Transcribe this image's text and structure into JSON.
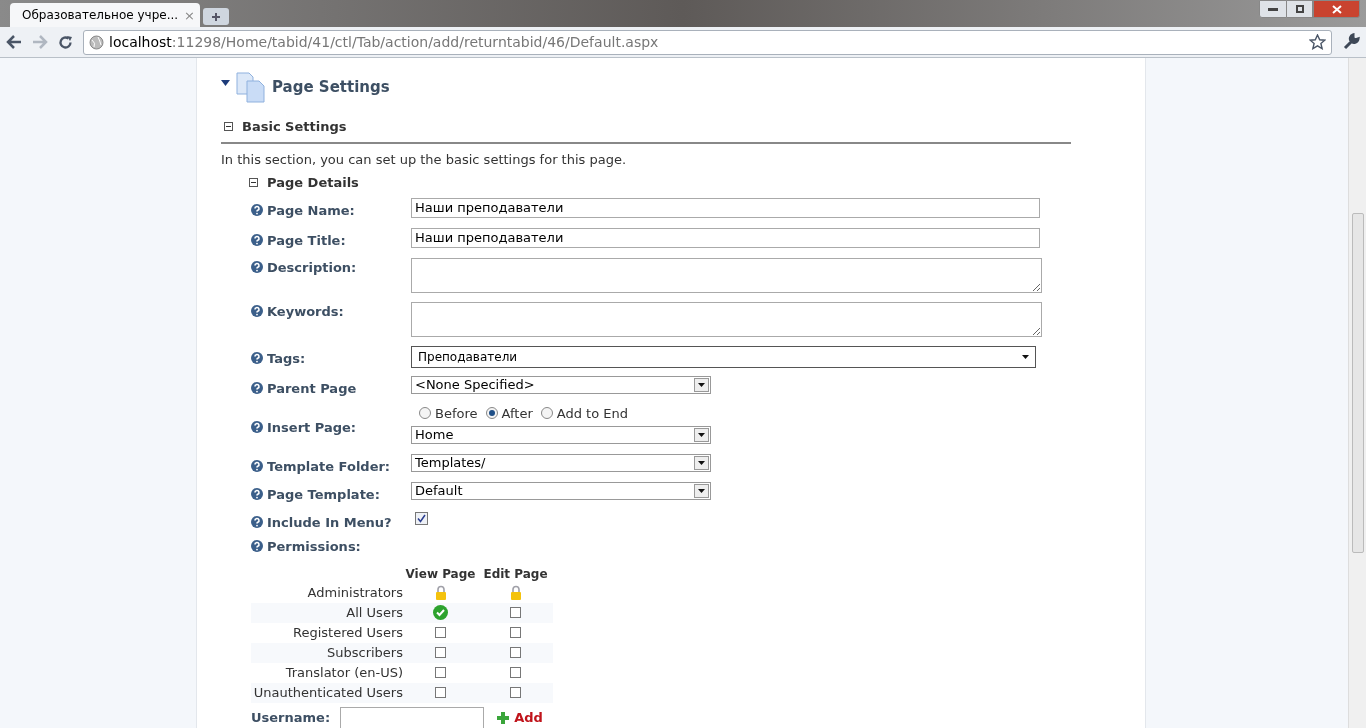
{
  "browser": {
    "tab_title": "Образовательное учре...",
    "tab_close": "×",
    "url_host": "localhost",
    "url_path": ":11298/Home/tabid/41/ctl/Tab/action/add/returntabid/46/Default.aspx"
  },
  "page": {
    "title": "Page Settings",
    "expanded": true
  },
  "section": {
    "title": "Basic Settings",
    "expanded": true,
    "intro": "In this section, you can set up the basic settings for this page.",
    "subsection": "Page Details",
    "subsection_expanded": true
  },
  "fields": [
    {
      "kind": "text",
      "label": "Page Name:",
      "value": "Наши преподаватели"
    },
    {
      "kind": "text",
      "label": "Page Title:",
      "value": "Наши преподаватели"
    },
    {
      "kind": "textarea",
      "label": "Description:"
    },
    {
      "kind": "textarea",
      "label": "Keywords:"
    },
    {
      "kind": "tags",
      "label": "Tags:",
      "value": "Преподаватели"
    },
    {
      "kind": "select",
      "label": "Parent Page",
      "value": "<None Specified>"
    },
    {
      "kind": "insert",
      "label": "Insert Page:",
      "options": [
        {
          "label": "Before",
          "selected": false
        },
        {
          "label": "After",
          "selected": true
        },
        {
          "label": "Add to End",
          "selected": false
        }
      ],
      "value": "Home"
    },
    {
      "kind": "select",
      "label": "Template Folder:",
      "value": "Templates/"
    },
    {
      "kind": "select",
      "label": "Page Template:",
      "value": "Default"
    },
    {
      "kind": "checkbox",
      "label": "Include In Menu?",
      "checked": true
    },
    {
      "kind": "heading",
      "label": "Permissions:"
    }
  ],
  "permissions": {
    "columns": [
      "View Page",
      "Edit Page"
    ],
    "rows": [
      {
        "role": "Administrators",
        "cells": [
          {
            "kind": "lock"
          },
          {
            "kind": "lock"
          }
        ]
      },
      {
        "role": "All Users",
        "cells": [
          {
            "kind": "checkbox",
            "checked": true
          },
          {
            "kind": "checkbox",
            "checked": false
          }
        ]
      },
      {
        "role": "Registered Users",
        "cells": [
          {
            "kind": "checkbox",
            "checked": false
          },
          {
            "kind": "checkbox",
            "checked": false
          }
        ]
      },
      {
        "role": "Subscribers",
        "cells": [
          {
            "kind": "checkbox",
            "checked": false
          },
          {
            "kind": "checkbox",
            "checked": false
          }
        ]
      },
      {
        "role": "Translator (en-US)",
        "cells": [
          {
            "kind": "checkbox",
            "checked": false
          },
          {
            "kind": "checkbox",
            "checked": false
          }
        ]
      },
      {
        "role": "Unauthenticated Users",
        "cells": [
          {
            "kind": "checkbox",
            "checked": false
          },
          {
            "kind": "checkbox",
            "checked": false
          }
        ]
      }
    ],
    "username_label": "Username:",
    "add_label": "Add"
  }
}
